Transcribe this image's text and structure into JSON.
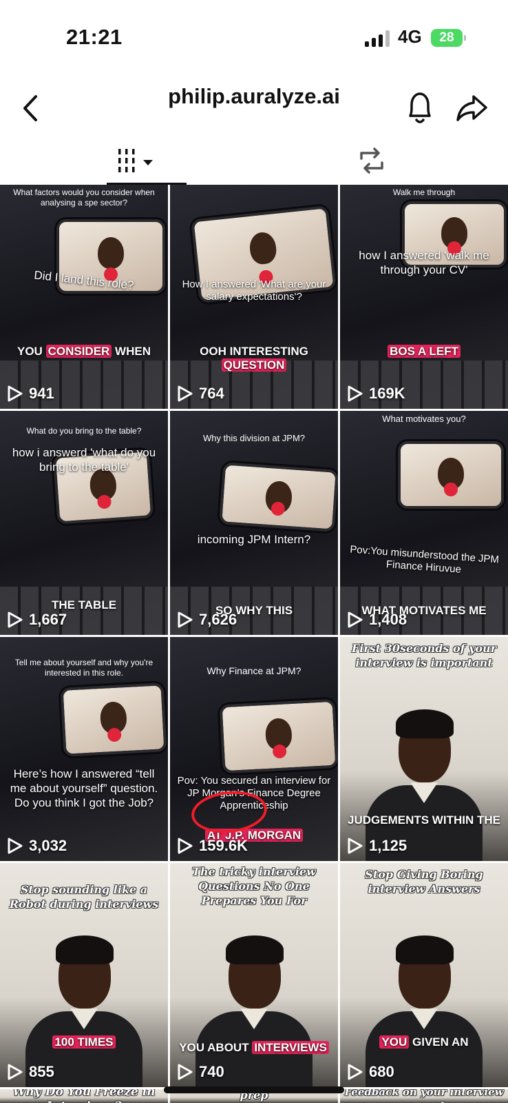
{
  "status_bar": {
    "time": "21:21",
    "network": "4G",
    "battery": "28"
  },
  "header": {
    "title": "philip.auralyze.ai"
  },
  "tabs": [
    {
      "icon": "grid-dropdown-icon"
    },
    {
      "icon": "repost-icon"
    }
  ],
  "videos": [
    {
      "top": "What factors would you consider when analysing a spe sector?",
      "overlay": "Did I land this role?",
      "caption": [
        "YOU",
        "CONSIDER",
        "WHEN"
      ],
      "views": "941"
    },
    {
      "top": "",
      "overlay": "How I answered 'What are your salary expectations'?",
      "caption": [
        "OOH INTERESTING",
        "QUESTION",
        ""
      ],
      "views": "764"
    },
    {
      "top": "Walk me through",
      "overlay": "how I answered 'walk me through your CV'",
      "caption": [
        "BOS A LEFT",
        "",
        ""
      ],
      "views": "169K"
    },
    {
      "top": "What do you bring to the table?",
      "overlay": "how i answerd 'what do you bring to the table'",
      "caption": [
        "THE TABLE",
        "",
        ""
      ],
      "views": "1,667"
    },
    {
      "top": "Why this division at JPM?",
      "overlay": "incoming JPM Intern?",
      "caption": [
        "SO WHY THIS",
        "",
        ""
      ],
      "views": "7,626"
    },
    {
      "top": "What motivates you?",
      "overlay": "Pov:You misunderstood the JPM Finance Hiruvue",
      "caption": [
        "WHAT MOTIVATES ME",
        "",
        ""
      ],
      "views": "1,408"
    },
    {
      "top": "Tell me about yourself and why you're interested in this role.",
      "overlay": "Here’s how I answered “tell me about yourself” question. Do you think I got the Job?",
      "caption": [
        "",
        "",
        ""
      ],
      "views": "3,032"
    },
    {
      "top": "Why Finance at JPM?",
      "overlay": "Pov: You secured an interview for JP Morgan’s Finance Degree Apprenticeship",
      "caption": [
        "AT J.P. MORGAN",
        "",
        ""
      ],
      "views": "159.6K"
    },
    {
      "top": "First 30seconds of your interview is important",
      "overlay": "",
      "caption": [
        "JUDGEMENTS WITHIN THE",
        "",
        ""
      ],
      "views": "1,125"
    },
    {
      "top": "Stop sounding like a Robot during interviews",
      "overlay": "",
      "caption": [
        "100 TIMES",
        "",
        ""
      ],
      "views": "855"
    },
    {
      "top": "The tricky interview Questions No One Prepares You For",
      "overlay": "",
      "caption": [
        "YOU ABOUT",
        "INTERVIEWS",
        ""
      ],
      "views": "740"
    },
    {
      "top": "Stop Giving Boring interview Answers",
      "overlay": "",
      "caption": [
        "YOU",
        "GIVEN AN",
        ""
      ],
      "views": "680"
    },
    {
      "top": "Why Do You Freeze in Interviews?",
      "overlay": "",
      "caption": [
        "",
        "",
        ""
      ],
      "views": ""
    },
    {
      "top": "prep",
      "overlay": "",
      "caption": [
        "",
        "",
        ""
      ],
      "views": ""
    },
    {
      "top": "Feedback on your interview answers made easy",
      "overlay": "",
      "caption": [
        "",
        "",
        ""
      ],
      "views": ""
    }
  ],
  "colors": {
    "highlight": "#e3245a",
    "annotation_circle": "#f01c2a",
    "battery": "#4cd964"
  }
}
